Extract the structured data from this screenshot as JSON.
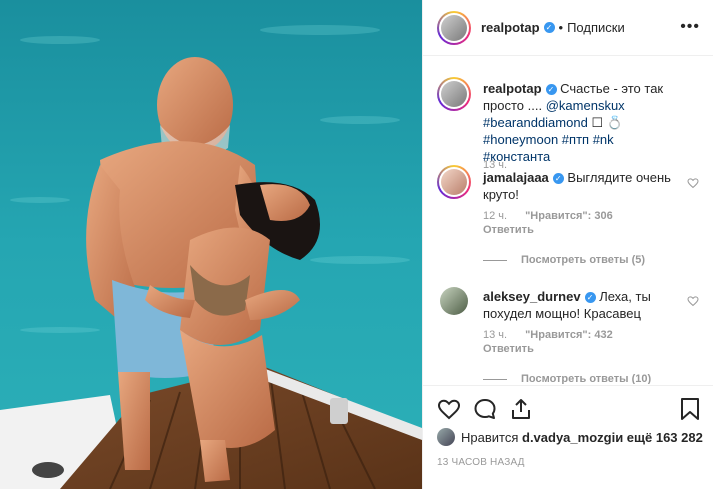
{
  "post": {
    "author": "realpotap",
    "dot": "•",
    "follow_label": "Подписки",
    "more_label": "•••",
    "caption": {
      "author": "realpotap",
      "text_1": " Счастье - это так просто ....",
      "mention": "@kamenskux",
      "tag_1": "#bearanddiamond",
      "tag_2": "#honeymoon",
      "tag_3": "#птп",
      "tag_4": "#nk",
      "tag_5": "#константа",
      "time": "13 ч."
    },
    "comments": [
      {
        "author": "jamalajaaa",
        "text": "Выглядите очень круто!",
        "time": "12 ч.",
        "likes": "\"Нравится\": 306",
        "reply_label": "Ответить",
        "view_replies": "Посмотреть ответы (5)"
      },
      {
        "author": "aleksey_durnev",
        "text": "Леха, ты похудел мощно! Красавец",
        "time": "13 ч.",
        "likes": "\"Нравится\": 432",
        "reply_label": "Ответить",
        "view_replies": "Посмотреть ответы (10)"
      }
    ],
    "likes_prefix": "Нравится ",
    "likes_user": "d.vadya_mozgi",
    "likes_suffix": " и ещё 163 282",
    "date": "13 ЧАСОВ НАЗАД"
  },
  "icons": {
    "like": "heart-icon",
    "comment": "comment-icon",
    "share": "share-icon",
    "save": "bookmark-icon",
    "verified": "verified-badge-icon"
  },
  "colors": {
    "verified": "#3897f0",
    "link": "#003569",
    "muted": "#999999",
    "sea": "#1f9aa8"
  }
}
